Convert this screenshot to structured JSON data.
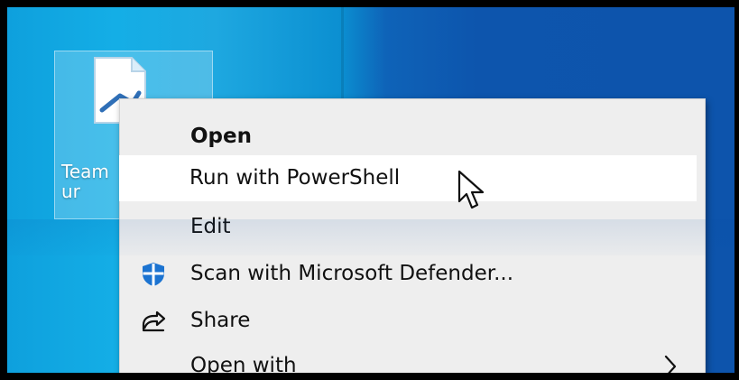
{
  "desktop": {
    "file_label": "Team\nur"
  },
  "context_menu": {
    "items": [
      {
        "label": "Open",
        "icon": "none",
        "default": true,
        "highlighted": false,
        "has_submenu": false
      },
      {
        "label": "Run with PowerShell",
        "icon": "none",
        "default": false,
        "highlighted": true,
        "has_submenu": false
      },
      {
        "label": "Edit",
        "icon": "none",
        "default": false,
        "highlighted": false,
        "has_submenu": false
      },
      {
        "label": "Scan with Microsoft Defender...",
        "icon": "defender-shield-icon",
        "default": false,
        "highlighted": false,
        "has_submenu": false
      },
      {
        "label": "Share",
        "icon": "share-icon",
        "default": false,
        "highlighted": false,
        "has_submenu": false
      },
      {
        "label": "Open with",
        "icon": "none",
        "default": false,
        "highlighted": false,
        "has_submenu": true,
        "submenu_icon": "chevron-right-icon"
      }
    ]
  },
  "colors": {
    "desktop_left": "#14aee6",
    "desktop_right": "#0d54ac",
    "menu_background": "#eeeeee",
    "menu_highlight": "#ffffff",
    "defender_blue": "#1b73d1",
    "text": "#111111"
  },
  "cursor": {
    "icon": "mouse-pointer-icon"
  }
}
